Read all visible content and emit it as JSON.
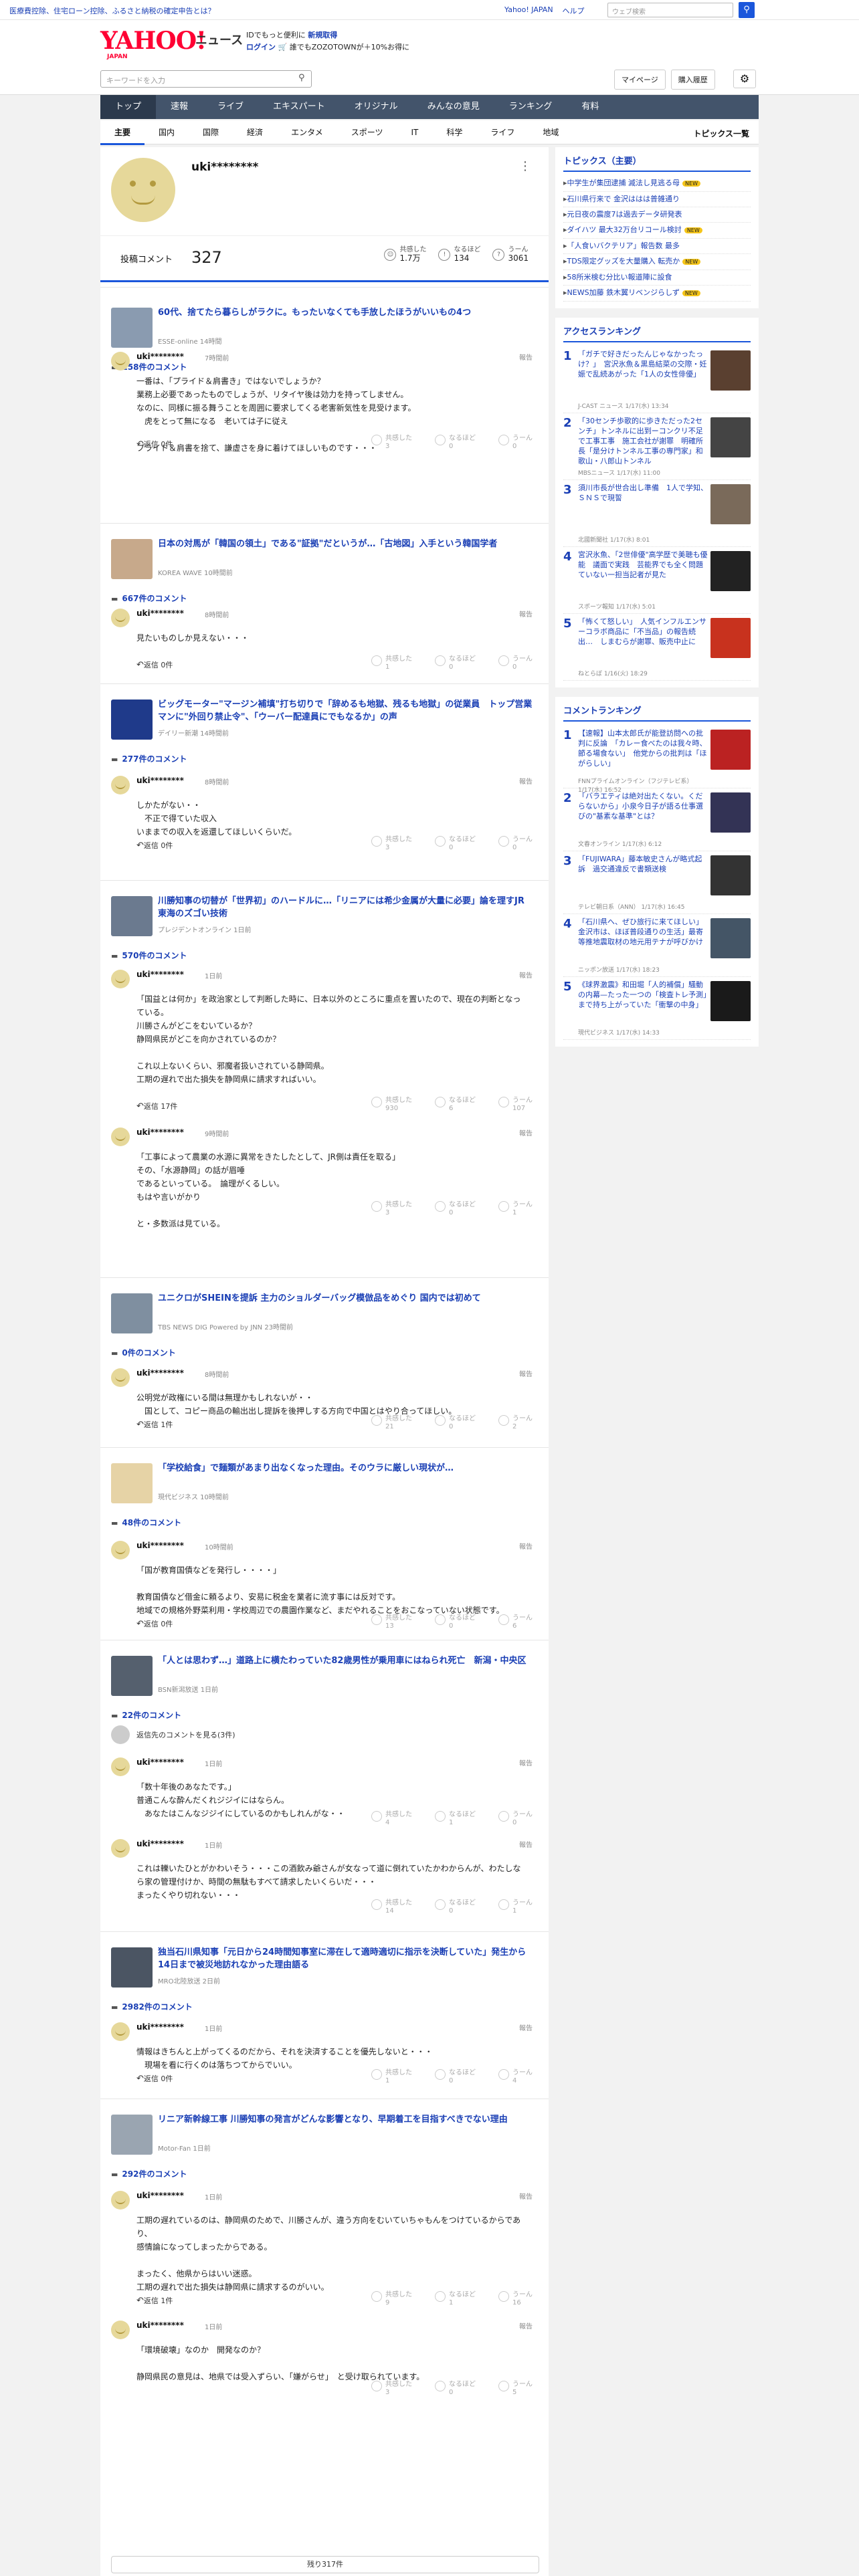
{
  "header": {
    "ad": "医療費控除、住宅ローン控除、ふるさと納税の確定申告とは？",
    "links": [
      "Yahoo! JAPAN",
      "ヘルプ"
    ],
    "web_search_placeholder": "ウェブ検索",
    "logo": "YAHOO!",
    "logo_sub": "JAPAN",
    "logo_news": "ニュース",
    "promo1_a": "IDでもっと便利に",
    "promo1_b": "新規取得",
    "promo2_a": "ログイン",
    "promo2_b": "誰でもZOZOTOWNが＋10%お得に"
  },
  "search": {
    "placeholder": "キーワードを入力",
    "mypage": "マイページ",
    "purchase": "購入履歴"
  },
  "nav": [
    "トップ",
    "速報",
    "ライブ",
    "エキスパート",
    "オリジナル",
    "みんなの意見",
    "ランキング",
    "有料"
  ],
  "subnav": [
    "主要",
    "国内",
    "国際",
    "経済",
    "エンタメ",
    "スポーツ",
    "IT",
    "科学",
    "ライフ",
    "地域"
  ],
  "subnav_all": "トピックス一覧",
  "profile": {
    "name": "uki********",
    "comment_label": "投稿コメント",
    "comment_count": "327",
    "reactions": [
      {
        "label": "共感した",
        "value": "1.7万"
      },
      {
        "label": "なるほど",
        "value": "134"
      },
      {
        "label": "うーん",
        "value": "3061"
      }
    ]
  },
  "articles": [
    {
      "title": "60代、捨てたら暮らしがラクに。もったいなくても手放したほうがいいもの4つ",
      "src": "ESSE-online 14時間",
      "count": "158件のコメント",
      "comments": [
        {
          "user": "uki********",
          "time": "7時間前",
          "text": "一番は、「プライド＆肩書き」ではないでしょうか？\n業務上必要であったものでしょうが、リタイヤ後は効力を持ってしません。\nなのに、同様に振る舞うことを周囲に要求してくる老害新気性を見受けます。\n　虎をとって無になる　老いては子に従え\n\nプライド＆肩書を捨て、謙虚さを身に着けてほしいものです・・・",
          "reply": "返信 0件",
          "r": [
            "3",
            "0",
            "0"
          ]
        }
      ]
    },
    {
      "title": "日本の対馬が「韓国の領土」である\"証拠\"だというが…「古地図」入手という韓国学者",
      "src": "KOREA WAVE 10時間前",
      "count": "667件のコメント",
      "comments": [
        {
          "user": "uki********",
          "time": "8時間前",
          "text": "見たいものしか見えない・・・",
          "reply": "返信 0件",
          "r": [
            "1",
            "0",
            "0"
          ]
        }
      ]
    },
    {
      "title": "ビッグモーター\"マージン補填\"打ち切りで「辞めるも地獄、残るも地獄」の従業員　トップ営業マンに\"外回り禁止令\"、「ウーバー配達員にでもなるか」の声",
      "src": "デイリー新潮 14時間前",
      "count": "277件のコメント",
      "comments": [
        {
          "user": "uki********",
          "time": "8時間前",
          "text": "しかたがない・・\n　不正で得ていた収入\nいままでの収入を返還してほしいくらいだ。",
          "reply": "返信 0件",
          "r": [
            "3",
            "0",
            "0"
          ]
        }
      ]
    },
    {
      "title": "川勝知事の切替が「世界初」のハードルに…「リニアには希少金属が大量に必要」論を理すJR東海のズゴい技術",
      "src": "プレジデントオンライン 1日前",
      "count": "570件のコメント",
      "comments": [
        {
          "user": "uki********",
          "time": "1日前",
          "text": "「国益とは何か」を政治家として判断した時に、日本以外のところに重点を置いたので、現在の判断となっている。\n川勝さんがどこをむいているか？\n静岡県民がどこを向かされているのか？\n\nこれ以上ないくらい、邪魔者扱いされている静岡県。\n工期の遅れで出た損失を静岡県に請求すればいい。",
          "reply": "返信 17件",
          "r": [
            "930",
            "6",
            "107"
          ]
        },
        {
          "user": "uki********",
          "time": "9時間前",
          "text": "「工事によって農業の水源に異常をきたしたとして、JR側は責任を取る」\nその、「水源静岡」の話が眉唾\nであるといっている。　論理がくるしい。\nもはや言いがかり\n\nと・多数派は見ている。",
          "reply": "",
          "r": [
            "3",
            "0",
            "1"
          ]
        }
      ]
    },
    {
      "title": "ユニクロがSHEINを提訴 主力のショルダーバッグ模倣品をめぐり 国内では初めて",
      "src": "TBS NEWS DIG Powered by JNN 23時間前",
      "count": "0件のコメント",
      "comments": [
        {
          "user": "uki********",
          "time": "8時間前",
          "text": "公明党が政権にいる間は無理かもしれないが・・\n　国として、コピー商品の輸出出し提訴を後押しする方向で中国とはやり合ってほしい。",
          "reply": "返信 1件",
          "r": [
            "21",
            "0",
            "2"
          ]
        }
      ]
    },
    {
      "title": "「学校給食」で麺類があまり出なくなった理由。そのウラに厳しい現状が…",
      "src": "現代ビジネス 10時間前",
      "count": "48件のコメント",
      "comments": [
        {
          "user": "uki********",
          "time": "10時間前",
          "text": "「国が教育国債などを発行し・・・・」\n\n教育国債など借金に頼るより、安易に税金を業者に流す事には反対です。\n地域での規格外野菜利用・学校周辺での農園作業など、まだやれることをおこなっていない状態です。",
          "reply": "返信 0件",
          "r": [
            "13",
            "0",
            "6"
          ]
        }
      ]
    },
    {
      "title": "「人とは思わず…」道路上に横たわっていた82歳男性が乗用車にはねられ死亡　新潟・中央区",
      "src": "BSN新潟放送 1日前",
      "count": "22件のコメント",
      "hidden": "返信先のコメントを見る(3件)",
      "comments": [
        {
          "user": "uki********",
          "time": "1日前",
          "text": "「数十年後のあなたです。」\n普通こんな酔んだくれジジイにはならん。\n　あなたはこんなジジイにしているのかもしれんがな・・",
          "reply": "",
          "r": [
            "4",
            "1",
            "0"
          ]
        },
        {
          "user": "uki********",
          "time": "1日前",
          "text": "これは轢いたひとがかわいそう・・・この酒飲み爺さんが女なって道に倒れていたかわからんが、わたしなら家の管理付けか、時間の無駄もすべて請求したいくらいだ・・・\nまったくやり切れない・・・",
          "reply": "",
          "r": [
            "14",
            "0",
            "1"
          ]
        }
      ]
    },
    {
      "title": "独当石川県知事「元日から24時間知事室に滞在して適時適切に指示を決断していた」発生から14日まで被災地訪れなかった理由語る",
      "src": "MRO北陸放送 2日前",
      "count": "2982件のコメント",
      "comments": [
        {
          "user": "uki********",
          "time": "1日前",
          "text": "情報はきちんと上がってくるのだから、それを決済することを優先しないと・・・\n　現場を看に行くのは落ちつてからでいい。",
          "reply": "返信 0件",
          "r": [
            "1",
            "0",
            "4"
          ]
        }
      ]
    },
    {
      "title": "リニア新幹線工事 川勝知事の発言がどんな影響となり、早期着工を目指すべきでない理由",
      "src": "Motor-Fan 1日前",
      "count": "292件のコメント",
      "comments": [
        {
          "user": "uki********",
          "time": "1日前",
          "text": "工期の遅れているのは、静岡県のためで、川勝さんが、違う方向をむいていちゃもんをつけているからであり、\n感情論になってしまったからである。\n\nまったく、他県からはいい迷惑。\n工期の遅れで出た損失は静岡県に請求するのがいい。",
          "reply": "返信 1件",
          "r": [
            "9",
            "1",
            "16"
          ]
        },
        {
          "user": "uki********",
          "time": "1日前",
          "text": "「環境破壊」なのか　開発なのか？\n\n静岡県民の意見は、地県では受入ずらい、「嫌がらせ」　と受け取られています。",
          "reply": "",
          "r": [
            "3",
            "0",
            "5"
          ]
        }
      ]
    }
  ],
  "more": "残り317件",
  "topics": {
    "title": "トピックス（主要）",
    "items": [
      {
        "t": "中学生が集団逮捕 滅法し見逃る母",
        "n": true
      },
      {
        "t": "石川県行来で 金沢ははは普雑通り",
        "n": false
      },
      {
        "t": "元日夜の震度7は過去データ研発表",
        "n": false
      },
      {
        "t": "ダイハツ 最大32万台リコール検討",
        "n": true
      },
      {
        "t": "「人食いバクテリア」報告数 最多",
        "n": false
      },
      {
        "t": "TDS限定グッズを大量購入 転売か",
        "n": true
      },
      {
        "t": "58所米検む分比い報道陣に設食",
        "n": false
      },
      {
        "t": "NEWS加藤 鉄木翼リベンジらしず",
        "n": true
      }
    ]
  },
  "access": {
    "title": "アクセスランキング",
    "items": [
      {
        "n": "1",
        "t": "「ガチで好きだったんじゃなかったっけ？」　宮沢氷魚＆黒島結菜の交際・妊娠で乱続あがった「1人の女性俳優」",
        "s": "J-CAST ニュース 1/17(水) 13:34",
        "c": "#5a4030"
      },
      {
        "n": "2",
        "t": "「30センチ歩歌的に歩きただった2センチ」トンネルに出到ーコンクリ不足で工事工事　施工会社が謝罪　明確所長「是分けトンネル工事の専門家」和歌山・八郎山トンネル",
        "s": "MBSニュース 1/17(水) 11:00",
        "c": "#444"
      },
      {
        "n": "3",
        "t": "須川市長が世合出し準備　1人で学知、ＳＮＳで現誓",
        "s": "北國新聞社 1/17(水) 8:01",
        "c": "#7a6a5a"
      },
      {
        "n": "4",
        "t": "宮沢氷魚、「2世俳優\"高学歴で美聴も優能　議面で実践　芸能界でも全く問題ていない一担当記者が見た",
        "s": "スポーツ報知 1/17(水) 5:01",
        "c": "#222"
      },
      {
        "n": "5",
        "t": "「怖くて怒しい」　人気インフルエンサーコラボ商品に「不当品」の報告続出…　しまむらが謝罪、販売中止に",
        "s": "ねとらぼ 1/16(火) 18:29",
        "c": "#c8321e"
      }
    ]
  },
  "ranking": {
    "title": "コメントランキング",
    "items": [
      {
        "n": "1",
        "t": "【速報】山本太郎氏が能登訪問への批判に反論　「カレー食べたのは我々時、節る場食ない」　他党からの批判は「ほがらしい」",
        "s": "FNNプライムオンライン（フジテレビ系） 1/17(水) 16:52",
        "c": "#b22"
      },
      {
        "n": "2",
        "t": "「バラエティは絶対出たくない。くだらないから」小泉今日子が語る仕事選びの\"基素な基準\"とは？",
        "s": "文春オンライン 1/17(水) 6:12",
        "c": "#335"
      },
      {
        "n": "3",
        "t": "「FUJIWARA」藤本敏史さんが略式起訴　過交通違反で書類送検",
        "s": "テレビ朝日系（ANN） 1/17(水) 16:45",
        "c": "#333"
      },
      {
        "n": "4",
        "t": "「石川県へ、ぜひ旅行に来てほしい」金沢市は、ほぼ普段通りの生活」最寄等推地震取材の地元用テナが呼びかけ",
        "s": "ニッポン放送 1/17(水) 18:23",
        "c": "#456"
      },
      {
        "n": "5",
        "t": "《球界激震》和田堀「人的補償」騒動の内幕—たった一つの「検査トレ予測」まで持ち上がっていた「衝撃の中身」",
        "s": "現代ビジネス 1/17(水) 14:33",
        "c": "#1a1a1a"
      }
    ]
  }
}
